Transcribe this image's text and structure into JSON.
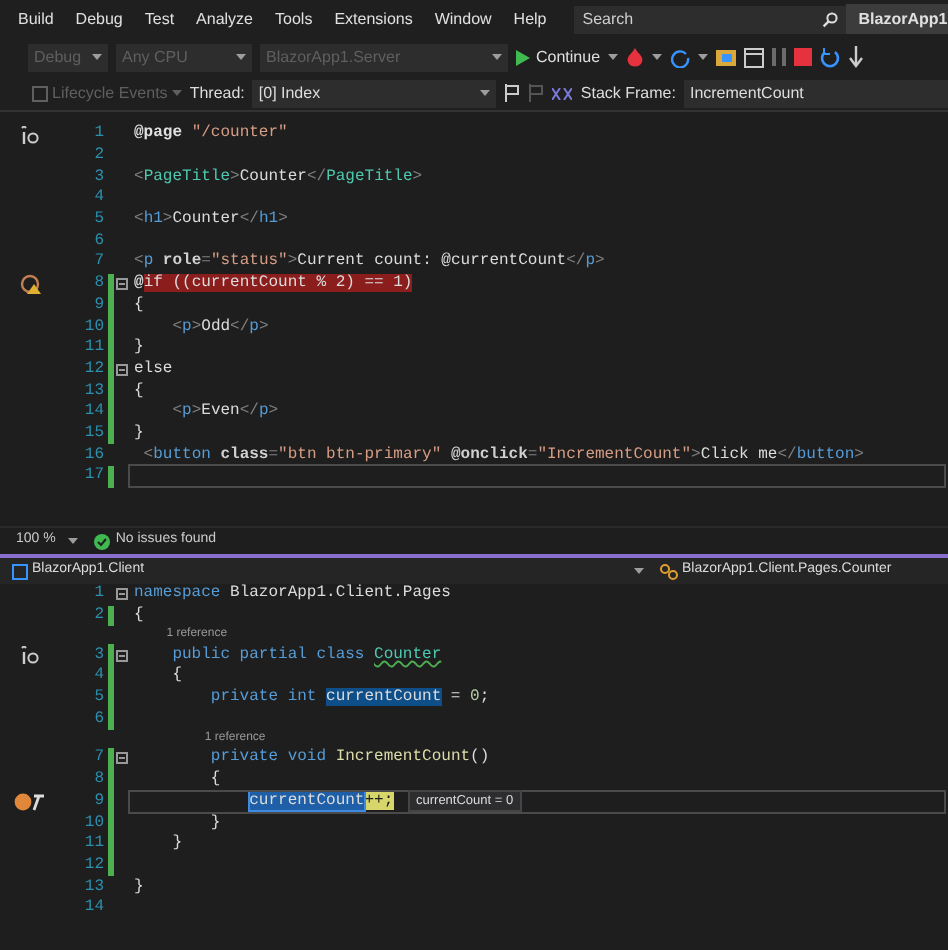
{
  "menu": [
    {
      "label": "Build"
    },
    {
      "label": "Debug"
    },
    {
      "label": "Test"
    },
    {
      "label": "Analyze"
    },
    {
      "label": "Tools"
    },
    {
      "label": "Extensions"
    },
    {
      "label": "Window"
    },
    {
      "label": "Help"
    }
  ],
  "search": {
    "placeholder": "Search"
  },
  "solution_badge": "BlazorApp1",
  "toolbar": {
    "configuration": "Debug",
    "platform": "Any CPU",
    "startup_project": "BlazorApp1.Server",
    "continue": "Continue"
  },
  "debug_location": {
    "lifecycle_events": "Lifecycle Events",
    "thread_label": "Thread:",
    "thread": "[0] Index",
    "stack_frame_label": "Stack Frame:",
    "stack_frame": "IncrementCount"
  },
  "razor_editor": {
    "lines": [
      {
        "n": "1",
        "hot_reload": true,
        "changed": false,
        "fold": false,
        "tokens": [
          {
            "kind": "razor",
            "text": "@page "
          },
          {
            "kind": "string",
            "text": "\"/counter\""
          }
        ]
      },
      {
        "n": "2",
        "changed": false,
        "fold": false
      },
      {
        "n": "3",
        "changed": false,
        "fold": false,
        "tokens": [
          {
            "kind": "punct",
            "text": "<"
          },
          {
            "kind": "component",
            "text": "PageTitle"
          },
          {
            "kind": "punct",
            "text": ">"
          },
          {
            "kind": "text",
            "text": "Counter"
          },
          {
            "kind": "punct",
            "text": "</"
          },
          {
            "kind": "component",
            "text": "PageTitle"
          },
          {
            "kind": "punct",
            "text": ">"
          }
        ]
      },
      {
        "n": "4",
        "changed": false,
        "fold": false
      },
      {
        "n": "5",
        "changed": false,
        "fold": false,
        "tokens": [
          {
            "kind": "punct",
            "text": "<"
          },
          {
            "kind": "tag",
            "text": "h1"
          },
          {
            "kind": "punct",
            "text": ">"
          },
          {
            "kind": "text",
            "text": "Counter"
          },
          {
            "kind": "punct",
            "text": "</"
          },
          {
            "kind": "tag",
            "text": "h1"
          },
          {
            "kind": "punct",
            "text": ">"
          }
        ]
      },
      {
        "n": "6",
        "changed": false,
        "fold": false
      },
      {
        "n": "7",
        "changed": false,
        "fold": false,
        "tokens": [
          {
            "kind": "punct",
            "text": "<"
          },
          {
            "kind": "tag",
            "text": "p"
          },
          {
            "kind": "attr",
            "text": " role"
          },
          {
            "kind": "punct",
            "text": "="
          },
          {
            "kind": "string",
            "text": "\"status\""
          },
          {
            "kind": "punct",
            "text": ">"
          },
          {
            "kind": "text",
            "text": "Current count: @currentCount"
          },
          {
            "kind": "punct",
            "text": "</"
          },
          {
            "kind": "tag",
            "text": "p"
          },
          {
            "kind": "punct",
            "text": ">"
          }
        ]
      },
      {
        "n": "8",
        "breakpoint_warning": true,
        "changed": true,
        "fold": true,
        "tokens": [
          {
            "kind": "razor",
            "text": "@"
          },
          {
            "kind": "text",
            "text": "if ((currentCount % 2) == 1)",
            "breakpoint_highlight": true
          }
        ]
      },
      {
        "n": "9",
        "changed": true,
        "fold": false,
        "tokens": [
          {
            "kind": "text",
            "text": "{"
          }
        ]
      },
      {
        "n": "10",
        "changed": true,
        "fold": false,
        "tokens": [
          {
            "kind": "punct",
            "text": "    <"
          },
          {
            "kind": "tag",
            "text": "p"
          },
          {
            "kind": "punct",
            "text": ">"
          },
          {
            "kind": "text",
            "text": "Odd"
          },
          {
            "kind": "punct",
            "text": "</"
          },
          {
            "kind": "tag",
            "text": "p"
          },
          {
            "kind": "punct",
            "text": ">"
          }
        ]
      },
      {
        "n": "11",
        "changed": true,
        "fold": false,
        "tokens": [
          {
            "kind": "text",
            "text": "}"
          }
        ]
      },
      {
        "n": "12",
        "changed": true,
        "fold": true,
        "tokens": [
          {
            "kind": "text",
            "text": "else"
          }
        ]
      },
      {
        "n": "13",
        "changed": true,
        "fold": false,
        "tokens": [
          {
            "kind": "text",
            "text": "{"
          }
        ]
      },
      {
        "n": "14",
        "changed": true,
        "fold": false,
        "tokens": [
          {
            "kind": "punct",
            "text": "    <"
          },
          {
            "kind": "tag",
            "text": "p"
          },
          {
            "kind": "punct",
            "text": ">"
          },
          {
            "kind": "text",
            "text": "Even"
          },
          {
            "kind": "punct",
            "text": "</"
          },
          {
            "kind": "tag",
            "text": "p"
          },
          {
            "kind": "punct",
            "text": ">"
          }
        ]
      },
      {
        "n": "15",
        "changed": true,
        "fold": false,
        "tokens": [
          {
            "kind": "text",
            "text": "}"
          }
        ]
      },
      {
        "n": "16",
        "changed": false,
        "fold": false,
        "tokens": [
          {
            "kind": "punct",
            "text": " <"
          },
          {
            "kind": "tag",
            "text": "button"
          },
          {
            "kind": "attr",
            "text": " class"
          },
          {
            "kind": "punct",
            "text": "="
          },
          {
            "kind": "string",
            "text": "\"btn btn-primary\""
          },
          {
            "kind": "attr",
            "text": " @onclick"
          },
          {
            "kind": "punct",
            "text": "="
          },
          {
            "kind": "string",
            "text": "\"IncrementCount\""
          },
          {
            "kind": "punct",
            "text": ">"
          },
          {
            "kind": "text",
            "text": "Click me"
          },
          {
            "kind": "punct",
            "text": "</"
          },
          {
            "kind": "tag",
            "text": "button"
          },
          {
            "kind": "punct",
            "text": ">"
          }
        ]
      },
      {
        "n": "17",
        "changed": true,
        "fold": false,
        "current_line": true
      }
    ]
  },
  "status_bar": {
    "zoom": "100 %",
    "issues": "No issues found"
  },
  "csharp_editor": {
    "project": "BlazorApp1.Client",
    "member": "BlazorApp1.Client.Pages.Counter",
    "lines": [
      {
        "n": "1",
        "changed": false,
        "fold": true,
        "tokens": [
          {
            "kind": "keyword",
            "text": "namespace"
          },
          {
            "kind": "text",
            "text": " BlazorApp1.Client.Pages"
          }
        ]
      },
      {
        "n": "2",
        "changed": true,
        "fold": false,
        "tokens": [
          {
            "kind": "text",
            "text": "{"
          }
        ]
      },
      {
        "n": "3",
        "hot_reload": true,
        "lens": "1 reference",
        "changed": true,
        "fold": true,
        "tokens": [
          {
            "kind": "keyword",
            "text": "    public partial class "
          },
          {
            "kind": "type",
            "text": "Counter",
            "squiggle": true
          }
        ]
      },
      {
        "n": "4",
        "changed": true,
        "fold": false,
        "tokens": [
          {
            "kind": "text",
            "text": "    {"
          }
        ]
      },
      {
        "n": "5",
        "changed": true,
        "fold": false,
        "tokens": [
          {
            "kind": "keyword",
            "text": "        private int "
          },
          {
            "kind": "text",
            "text": "currentCount",
            "reference_highlight": true
          },
          {
            "kind": "text",
            "text": " = "
          },
          {
            "kind": "number",
            "text": "0"
          },
          {
            "kind": "text",
            "text": ";"
          }
        ]
      },
      {
        "n": "6",
        "changed": true,
        "fold": false
      },
      {
        "n": "7",
        "lens": "1 reference",
        "changed": true,
        "fold": true,
        "tokens": [
          {
            "kind": "keyword",
            "text": "        private void "
          },
          {
            "kind": "method",
            "text": "IncrementCount"
          },
          {
            "kind": "text",
            "text": "()"
          }
        ]
      },
      {
        "n": "8",
        "changed": true,
        "fold": false,
        "tokens": [
          {
            "kind": "text",
            "text": "        {"
          }
        ]
      },
      {
        "n": "9",
        "breakpoint_hit": true,
        "changed": true,
        "fold": false,
        "current_line": true,
        "datatip": "currentCount = 0",
        "tokens": [
          {
            "kind": "text",
            "text": "            currentCount",
            "selected": true
          },
          {
            "text": "++;",
            "current_statement": true
          }
        ]
      },
      {
        "n": "10",
        "changed": true,
        "fold": false,
        "tokens": [
          {
            "kind": "text",
            "text": "        }"
          }
        ]
      },
      {
        "n": "11",
        "changed": true,
        "fold": false,
        "tokens": [
          {
            "kind": "text",
            "text": "    }"
          }
        ]
      },
      {
        "n": "12",
        "changed": true,
        "fold": false
      },
      {
        "n": "13",
        "changed": false,
        "fold": false,
        "tokens": [
          {
            "kind": "text",
            "text": "}"
          }
        ]
      },
      {
        "n": "14",
        "changed": false,
        "fold": false
      }
    ]
  }
}
